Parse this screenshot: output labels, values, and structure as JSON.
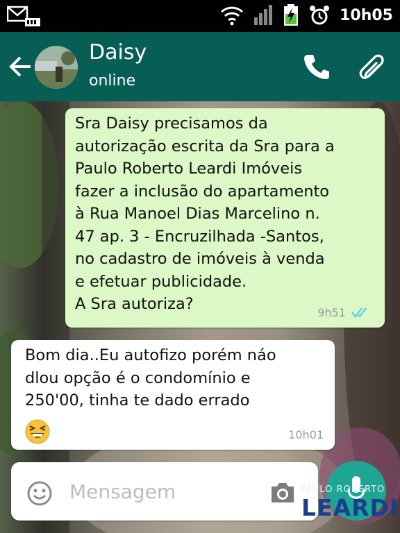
{
  "status_bar": {
    "time": "10h05"
  },
  "header": {
    "contact_name": "Daisy",
    "contact_status": "online"
  },
  "messages": [
    {
      "direction": "outgoing",
      "text": "Sra Daisy precisamos da\nautorização escrita da Sra para a\nPaulo Roberto Leardi Imóveis\nfazer a inclusão do apartamento\nà Rua Manoel Dias Marcelino n.\n47 ap. 3 - Encruzilhada -Santos,\nno cadastro de imóveis à venda\ne efetuar publicidade.\nA Sra autoriza?",
      "time": "9h51",
      "status_icon": "double-check-read-icon"
    },
    {
      "direction": "incoming",
      "text": "Bom dia..Eu autofizo porém  náo\ndlou opção é o condomínio e\n250'00, tinha te dado errado",
      "emoji": "grinning-squinting-face-icon",
      "time": "10h01"
    }
  ],
  "composer": {
    "placeholder": "Mensagem"
  },
  "watermark": {
    "top_text": "PAULO ROBERTO",
    "main_text": "LEARDI"
  },
  "colors": {
    "header": "#075e54",
    "outgoing_bubble": "#dcf8c6",
    "incoming_bubble": "#ffffff",
    "mic_button": "#1ea693",
    "read_ticks": "#4fc3f7"
  }
}
